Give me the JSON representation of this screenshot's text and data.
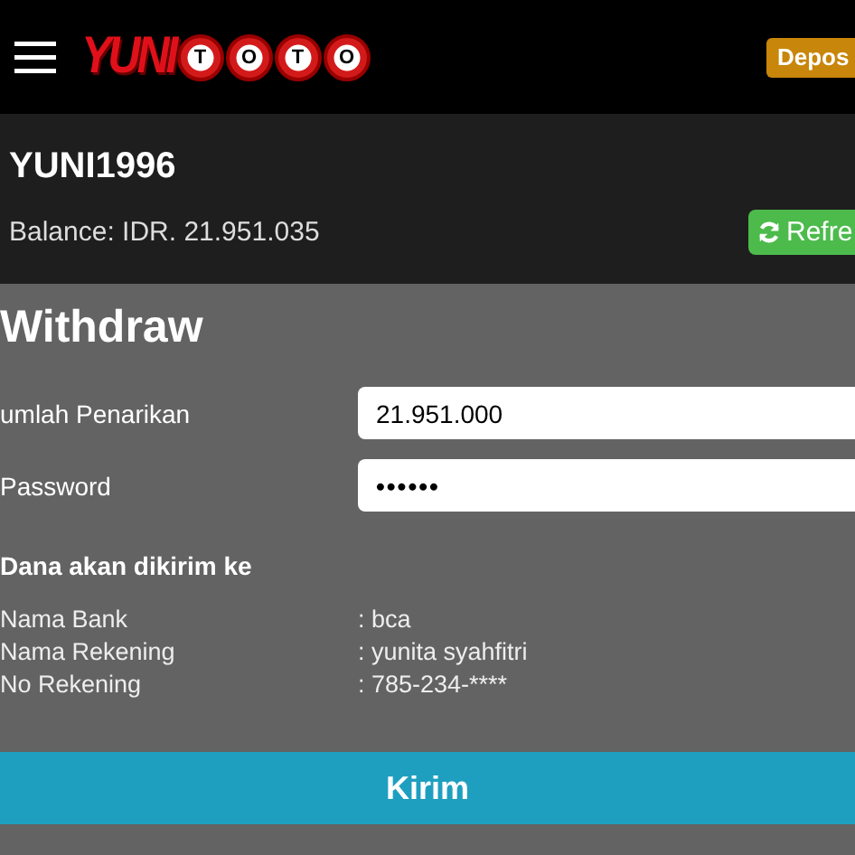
{
  "header": {
    "logo": {
      "brand": "YUNI",
      "balls": [
        "T",
        "O",
        "T",
        "O"
      ]
    },
    "deposit_button": "Depos"
  },
  "account": {
    "username": "YUNI1996",
    "balance": "Balance: IDR. 21.951.035",
    "refresh_button": "Refre"
  },
  "withdraw": {
    "title": "Withdraw",
    "fields": [
      {
        "label": "umlah Penarikan",
        "value": "21.951.000",
        "kind": "text"
      },
      {
        "label": "Password",
        "value": "••••••",
        "kind": "password"
      }
    ],
    "destination_heading": "Dana akan dikirim ke",
    "details": [
      {
        "label": "Nama Bank",
        "value": ": bca"
      },
      {
        "label": "Nama Rekening",
        "value": ": yunita syahfitri"
      },
      {
        "label": "No Rekening",
        "value": ": 785-234-****"
      }
    ],
    "submit_button": "Kirim"
  }
}
